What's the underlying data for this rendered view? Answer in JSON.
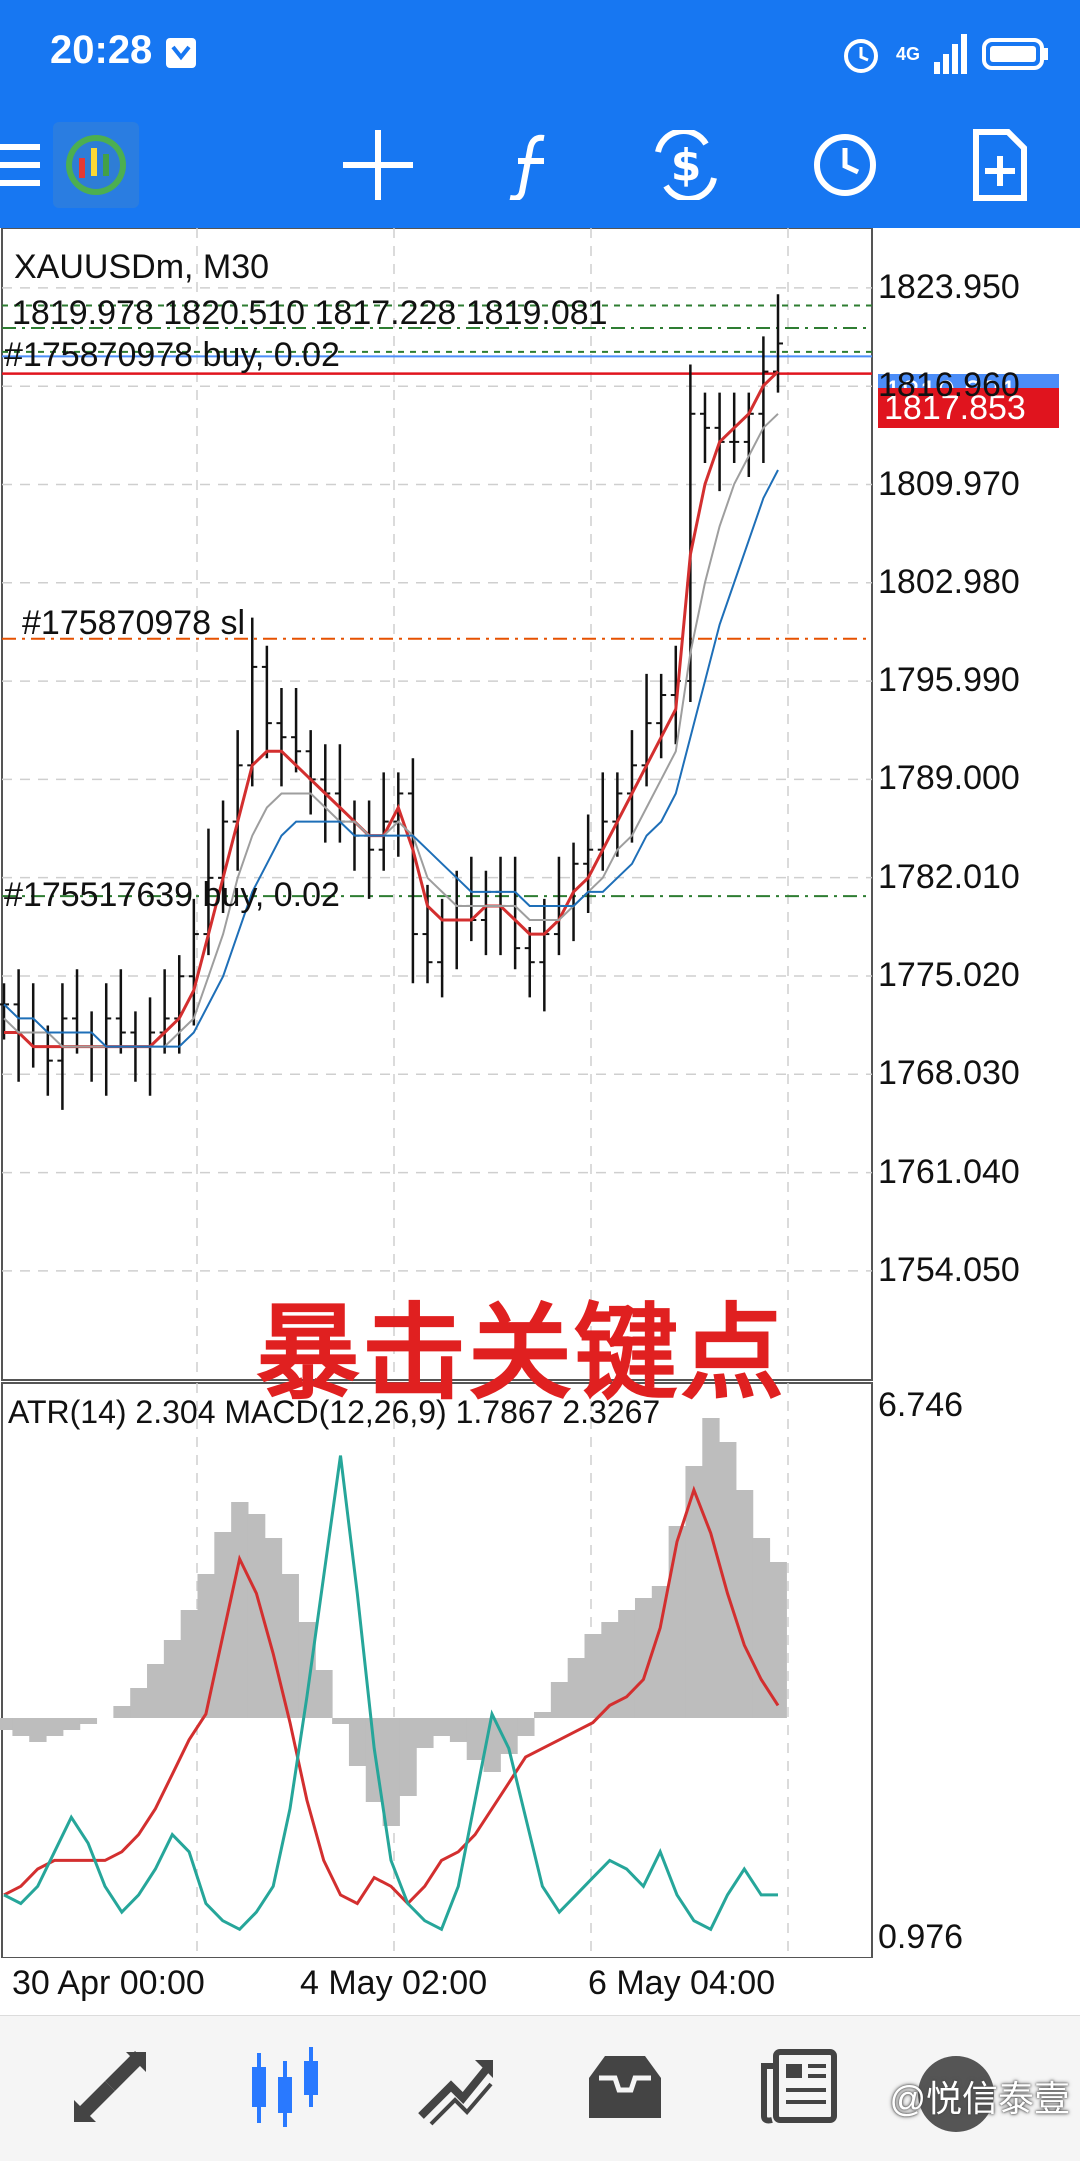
{
  "status": {
    "time": "20:28",
    "network": "4G"
  },
  "toolbar": {
    "items": [
      {
        "name": "menu-icon"
      },
      {
        "name": "app-logo"
      },
      {
        "name": "crosshair-icon"
      },
      {
        "name": "indicators-icon"
      },
      {
        "name": "trade-icon"
      },
      {
        "name": "period-clock-icon"
      },
      {
        "name": "new-order-icon"
      }
    ]
  },
  "chart_header": {
    "symbol": "XAUUSDm, M30",
    "ohlc": "1819.978 1820.510 1817.228 1819.081"
  },
  "order_lines": [
    {
      "label": "#175870978 buy, 0.02",
      "price": 1821.1,
      "color": "#2e7d32"
    },
    {
      "label": "#175870978 sl",
      "price": 1799.0,
      "color": "#e65100"
    },
    {
      "label": "#175517639 buy, 0.02",
      "price": 1780.7,
      "color": "#2e7d32"
    }
  ],
  "price_badges": {
    "ask": "1819.081",
    "bid": "1817.853",
    "ask_color": "#4b8df8",
    "bid_color": "#e0141e"
  },
  "annotation": {
    "text": "暴击关键点",
    "color": "#e02020"
  },
  "chart_data": [
    {
      "type": "candlestick",
      "title": "XAUUSDm, M30",
      "y_ticks": [
        "1823.950",
        "1816.960",
        "1809.970",
        "1802.980",
        "1795.990",
        "1789.000",
        "1782.010",
        "1775.020",
        "1768.030",
        "1761.040",
        "1754.050"
      ],
      "ylim": [
        1747.0,
        1827.5
      ],
      "x_ticks": [
        "30 Apr 00:00",
        "4 May 02:00",
        "6 May 04:00"
      ],
      "grid": true,
      "series": [
        {
          "type": "ohlc_close",
          "values": [
            1773,
            1771,
            1770,
            1769,
            1772,
            1771,
            1770,
            1772,
            1771,
            1770,
            1771,
            1772,
            1775,
            1778,
            1782,
            1786,
            1790,
            1797,
            1793,
            1792,
            1791,
            1789,
            1788,
            1786,
            1785,
            1784,
            1786,
            1788,
            1778,
            1776,
            1779,
            1780,
            1779,
            1781,
            1780,
            1777,
            1776,
            1778,
            1780,
            1783,
            1784,
            1786,
            1788,
            1790,
            1793,
            1795,
            1796,
            1815,
            1814,
            1813,
            1813,
            1815,
            1818,
            1820
          ]
        },
        {
          "name": "MA red",
          "type": "line",
          "color": "#d32f2f",
          "values": [
            1771,
            1771,
            1770,
            1770,
            1770,
            1770,
            1770,
            1770,
            1770,
            1770,
            1770,
            1771,
            1772,
            1774,
            1778,
            1782,
            1786,
            1790,
            1791,
            1791,
            1790,
            1789,
            1788,
            1787,
            1786,
            1785,
            1785,
            1787,
            1784,
            1780,
            1779,
            1779,
            1779,
            1780,
            1780,
            1779,
            1778,
            1778,
            1779,
            1781,
            1782,
            1784,
            1786,
            1788,
            1790,
            1792,
            1794,
            1805,
            1810,
            1813,
            1814,
            1815,
            1817,
            1818
          ]
        },
        {
          "name": "MA gray",
          "type": "line",
          "color": "#9e9e9e",
          "values": [
            1772,
            1771,
            1771,
            1771,
            1770,
            1770,
            1770,
            1770,
            1770,
            1770,
            1770,
            1770,
            1771,
            1772,
            1775,
            1778,
            1782,
            1785,
            1787,
            1788,
            1788,
            1788,
            1787,
            1786,
            1786,
            1785,
            1785,
            1786,
            1785,
            1782,
            1781,
            1780,
            1780,
            1780,
            1780,
            1780,
            1779,
            1779,
            1779,
            1780,
            1781,
            1782,
            1784,
            1785,
            1787,
            1789,
            1791,
            1798,
            1803,
            1807,
            1810,
            1812,
            1814,
            1815
          ]
        },
        {
          "name": "MA blue",
          "type": "line",
          "color": "#1e6fb8",
          "values": [
            1773,
            1772,
            1772,
            1771,
            1771,
            1771,
            1771,
            1770,
            1770,
            1770,
            1770,
            1770,
            1770,
            1771,
            1773,
            1775,
            1778,
            1781,
            1783,
            1785,
            1786,
            1786,
            1786,
            1786,
            1785,
            1785,
            1785,
            1785,
            1785,
            1784,
            1783,
            1782,
            1781,
            1781,
            1781,
            1781,
            1780,
            1780,
            1780,
            1780,
            1781,
            1781,
            1782,
            1783,
            1785,
            1786,
            1788,
            1792,
            1796,
            1800,
            1803,
            1806,
            1809,
            1811
          ]
        }
      ]
    },
    {
      "type": "indicator",
      "title": "ATR(14) 2.304 MACD(12,26,9) 1.7867 2.3267",
      "y_ticks": [
        "6.746",
        "0.976"
      ],
      "ylim": [
        0.976,
        6.746
      ],
      "series": [
        {
          "name": "MACD histogram",
          "type": "bar",
          "color": "#bdbdbd",
          "values": [
            -0.2,
            -0.3,
            -0.4,
            -0.3,
            -0.2,
            -0.1,
            0.0,
            0.2,
            0.5,
            0.9,
            1.3,
            1.8,
            2.4,
            3.1,
            3.6,
            3.4,
            3.0,
            2.4,
            1.6,
            0.8,
            -0.1,
            -0.8,
            -1.4,
            -1.8,
            -1.3,
            -0.5,
            -0.3,
            -0.4,
            -0.7,
            -0.9,
            -0.6,
            -0.3,
            0.1,
            0.6,
            1.0,
            1.4,
            1.6,
            1.8,
            2.0,
            2.2,
            3.2,
            4.2,
            5.0,
            4.6,
            3.8,
            3.0,
            2.6
          ]
        },
        {
          "name": "MACD signal",
          "type": "line",
          "color": "#d32f2f",
          "values": [
            1.5,
            1.6,
            1.8,
            1.9,
            1.9,
            1.9,
            1.9,
            2.0,
            2.2,
            2.5,
            2.9,
            3.3,
            3.6,
            4.5,
            5.4,
            5.0,
            4.3,
            3.5,
            2.6,
            1.9,
            1.5,
            1.4,
            1.7,
            1.6,
            1.4,
            1.6,
            1.9,
            2.0,
            2.2,
            2.5,
            2.8,
            3.1,
            3.2,
            3.3,
            3.4,
            3.5,
            3.7,
            3.8,
            4.0,
            4.6,
            5.6,
            6.2,
            5.7,
            5.0,
            4.4,
            4.0,
            3.7
          ]
        },
        {
          "name": "ATR",
          "type": "line",
          "color": "#26a69a",
          "values": [
            1.5,
            1.4,
            1.6,
            2.0,
            2.4,
            2.1,
            1.6,
            1.3,
            1.5,
            1.8,
            2.2,
            2.0,
            1.4,
            1.2,
            1.1,
            1.3,
            1.6,
            2.5,
            3.8,
            5.2,
            6.6,
            5.0,
            3.2,
            1.9,
            1.4,
            1.2,
            1.1,
            1.6,
            2.6,
            3.6,
            3.2,
            2.4,
            1.6,
            1.3,
            1.5,
            1.7,
            1.9,
            1.8,
            1.6,
            2.0,
            1.5,
            1.2,
            1.1,
            1.5,
            1.8,
            1.5,
            1.5
          ]
        }
      ]
    }
  ],
  "bottom_nav": [
    {
      "name": "quotes-icon"
    },
    {
      "name": "chart-icon"
    },
    {
      "name": "trade-nav-icon"
    },
    {
      "name": "history-icon"
    },
    {
      "name": "news-icon"
    }
  ],
  "watermark": "@悦信泰壹"
}
